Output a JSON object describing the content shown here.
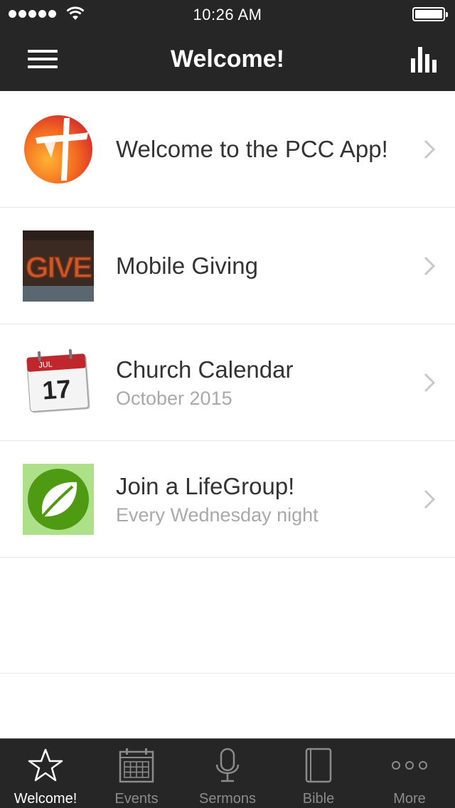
{
  "status_bar": {
    "time": "10:26 AM",
    "signal_icon": "cellular-dots-icon",
    "wifi_icon": "wifi-icon",
    "battery_icon": "battery-full-icon"
  },
  "header": {
    "title": "Welcome!",
    "menu_icon": "hamburger-menu-icon",
    "right_icon": "bar-chart-icon",
    "background": "#262626"
  },
  "list": {
    "items": [
      {
        "title": "Welcome to the PCC App!",
        "subtitle": "",
        "thumbnail": "pcc-cross-logo-icon"
      },
      {
        "title": "Mobile Giving",
        "subtitle": "",
        "thumbnail": "give-letters-image",
        "thumbnail_text": "GIVE"
      },
      {
        "title": "Church Calendar",
        "subtitle": "October 2015",
        "thumbnail": "calendar-icon",
        "thumbnail_month": "JUL",
        "thumbnail_day": "17"
      },
      {
        "title": "Join a LifeGroup!",
        "subtitle": "Every Wednesday night",
        "thumbnail": "leaf-icon"
      }
    ],
    "chevron_icon": "chevron-right-icon"
  },
  "tab_bar": {
    "active_color": "#ffffff",
    "inactive_color": "#8b8b8b",
    "tabs": [
      {
        "label": "Welcome!",
        "icon": "star-icon",
        "active": true
      },
      {
        "label": "Events",
        "icon": "calendar-icon",
        "active": false
      },
      {
        "label": "Sermons",
        "icon": "microphone-icon",
        "active": false
      },
      {
        "label": "Bible",
        "icon": "book-icon",
        "active": false
      },
      {
        "label": "More",
        "icon": "more-dots-icon",
        "active": false
      }
    ]
  }
}
